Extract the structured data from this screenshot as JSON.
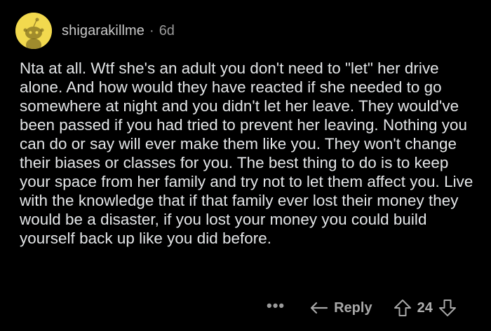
{
  "comment": {
    "username": "shigarakillme",
    "separator": "·",
    "age": "6d",
    "body": "Nta at all. Wtf she's an adult you don't need to \"let\" her drive alone. And how would they have reacted if she needed to go somewhere at night and you didn't let her leave. They would've been passed if you had tried to prevent her leaving. Nothing you can do or say will ever make them like you. They won't change their biases or classes for you. The best thing to do is to keep your space from her family and try not to let them affect you. Live with the knowledge that if that family ever lost their money they would be a disaster, if you lost your money you could build yourself back up like you did before.",
    "avatar_color": "#f2d94e"
  },
  "actions": {
    "more_label": "•••",
    "reply_label": "Reply",
    "vote_count": "24",
    "reply_icon": "reply-arrow-icon",
    "upvote_icon": "upvote-arrow-icon",
    "downvote_icon": "downvote-arrow-icon"
  }
}
